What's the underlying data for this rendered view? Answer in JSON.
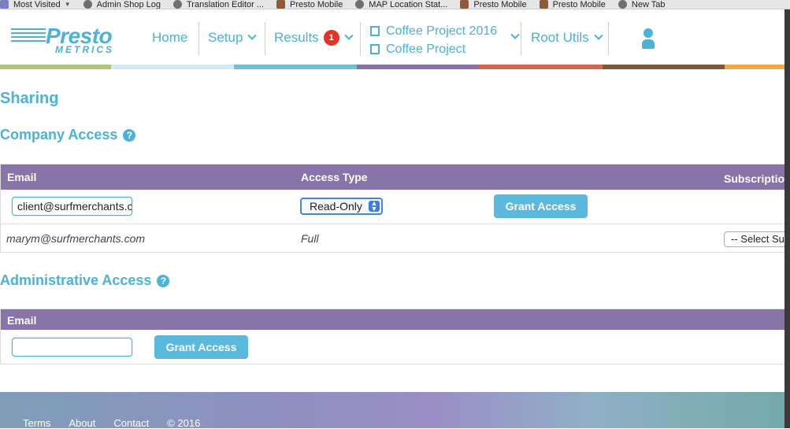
{
  "bookmarks": [
    {
      "label": "Most Visited",
      "icon": "most-visited-icon",
      "dropdown": true
    },
    {
      "label": "Admin Shop Log",
      "icon": "globe-icon"
    },
    {
      "label": "Translation Editor ...",
      "icon": "globe-icon"
    },
    {
      "label": "Presto Mobile",
      "icon": "presto-favicon-icon"
    },
    {
      "label": "MAP Location Stat...",
      "icon": "globe-icon"
    },
    {
      "label": "Presto Mobile",
      "icon": "presto-favicon-icon"
    },
    {
      "label": "Presto Mobile",
      "icon": "presto-favicon-icon"
    },
    {
      "label": "New Tab",
      "icon": "globe-icon"
    }
  ],
  "logo": {
    "word1": "Presto",
    "word2": "METRICS"
  },
  "nav": {
    "home": "Home",
    "setup": "Setup",
    "results": "Results",
    "results_badge": "1",
    "project_line1": "Coffee Project 2016",
    "project_line2": "Coffee Project",
    "root_utils": "Root Utils"
  },
  "colors": {
    "accent": "#4bb3d6",
    "table_header": "#8874a8",
    "badge": "#e2342b",
    "band": [
      "#b0c77a",
      "#d3ecf3",
      "#6fc0d3",
      "#8874a8",
      "#d2674e",
      "#7a5a3a",
      "#f0a943"
    ]
  },
  "page_title": "Sharing",
  "company_access": {
    "heading": "Company Access",
    "columns": {
      "email": "Email",
      "access_type": "Access Type",
      "subscription": "Subscription"
    },
    "new_row": {
      "email_value": "client@surfmerchants.c",
      "access_type": "Read-Only",
      "button": "Grant Access"
    },
    "rows": [
      {
        "email": "marym@surfmerchants.com",
        "access_type": "Full",
        "subscription_select": "-- Select Su"
      }
    ]
  },
  "admin_access": {
    "heading": "Administrative Access",
    "columns": {
      "email": "Email"
    },
    "new_row": {
      "email_value": "",
      "button": "Grant Access"
    }
  },
  "footer": {
    "terms": "Terms",
    "about": "About",
    "contact": "Contact",
    "copyright": "© 2016"
  }
}
